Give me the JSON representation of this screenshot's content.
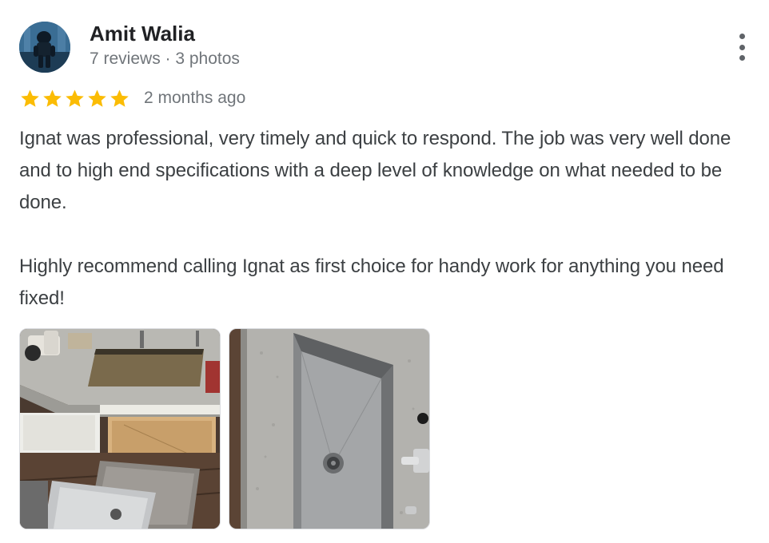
{
  "review": {
    "author": {
      "name": "Amit Walia",
      "meta": "7 reviews · 3 photos",
      "avatar": "avatar-photo"
    },
    "rating": 5,
    "max_rating": 5,
    "date": "2 months ago",
    "text": {
      "paragraph_1": "Ignat was professional, very timely and quick to respond. The job was very well done and to high end specifications with a deep level of knowledge on what needed to be done.",
      "paragraph_2": "Highly recommend calling Ignat as first choice for handy work for anything you need fixed!"
    },
    "photos": [
      {
        "name": "photo-kitchen-sink-removal"
      },
      {
        "name": "photo-stainless-sink-installed"
      }
    ],
    "icons": {
      "more": "more-vert-icon",
      "star": "star-icon"
    },
    "colors": {
      "star": "#fbbc04",
      "secondary_text": "#70757a",
      "body_text": "#3c4043"
    }
  }
}
